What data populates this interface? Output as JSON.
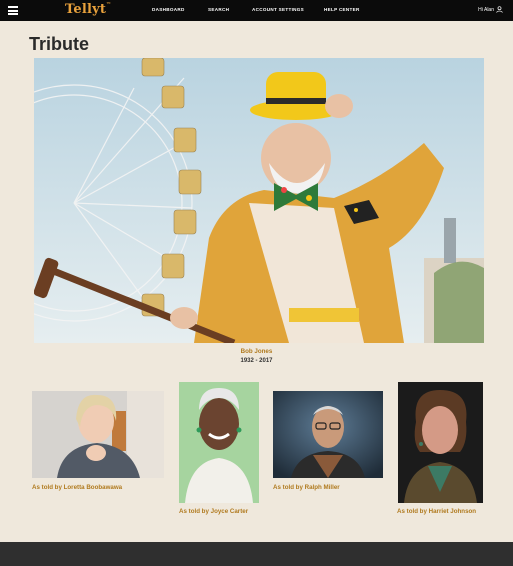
{
  "brand": {
    "logo_text": "Tellyt",
    "trademark": "™",
    "accent": "#e8a13c"
  },
  "nav": {
    "links": [
      "DASHBOARD",
      "SEARCH",
      "ACCOUNT SETTINGS",
      "HELP CENTER"
    ],
    "greeting": "Hi Alan"
  },
  "page": {
    "title": "Tribute"
  },
  "hero": {
    "name": "Bob Jones",
    "dates": "1932 - 2017"
  },
  "tributes": [
    {
      "caption": "As told by Loretta Boobawawa"
    },
    {
      "caption": "As told by Joyce Carter"
    },
    {
      "caption": "As told by Ralph Miller"
    },
    {
      "caption": "As told by Harriet Johnson"
    }
  ],
  "colors": {
    "caption": "#b07a1e",
    "nav_bg": "#0b0b0b",
    "page_bg": "#efe8dc",
    "footer_bg": "#2f2f2f"
  }
}
